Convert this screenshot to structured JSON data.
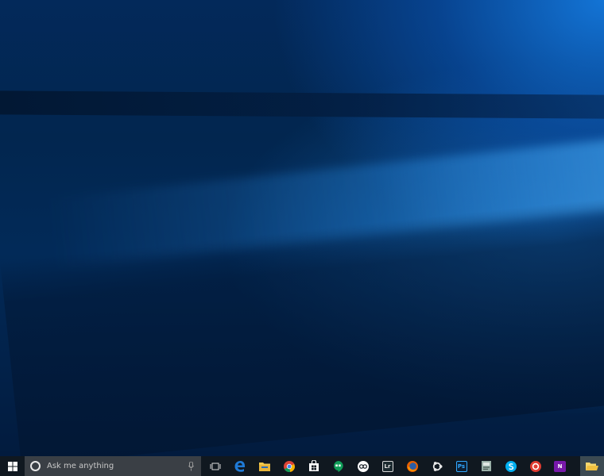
{
  "taskbar": {
    "search": {
      "placeholder": "Ask me anything"
    },
    "pinned": [
      {
        "name": "task-view-icon"
      },
      {
        "name": "edge-icon",
        "color": "#1f7ad6"
      },
      {
        "name": "file-explorer-icon",
        "color": "#f2c94c"
      },
      {
        "name": "chrome-icon"
      },
      {
        "name": "store-icon"
      },
      {
        "name": "hangouts-icon",
        "color": "#0f9d58"
      },
      {
        "name": "creative-cloud-icon"
      },
      {
        "name": "lightroom-icon",
        "label": "Lr"
      },
      {
        "name": "firefox-icon"
      },
      {
        "name": "ubuntu-icon"
      },
      {
        "name": "photoshop-icon",
        "label": "Ps",
        "color": "#31a8ff"
      },
      {
        "name": "notepad-icon"
      },
      {
        "name": "skype-icon",
        "color": "#00aff0"
      },
      {
        "name": "app-red-icon",
        "color": "#e03c31"
      },
      {
        "name": "onenote-icon",
        "label": "N",
        "color": "#7719aa"
      }
    ]
  },
  "colors": {
    "taskbar_bg": "#101820",
    "search_bg": "#3a3f45",
    "wallpaper_blue": "#0b5db4"
  }
}
